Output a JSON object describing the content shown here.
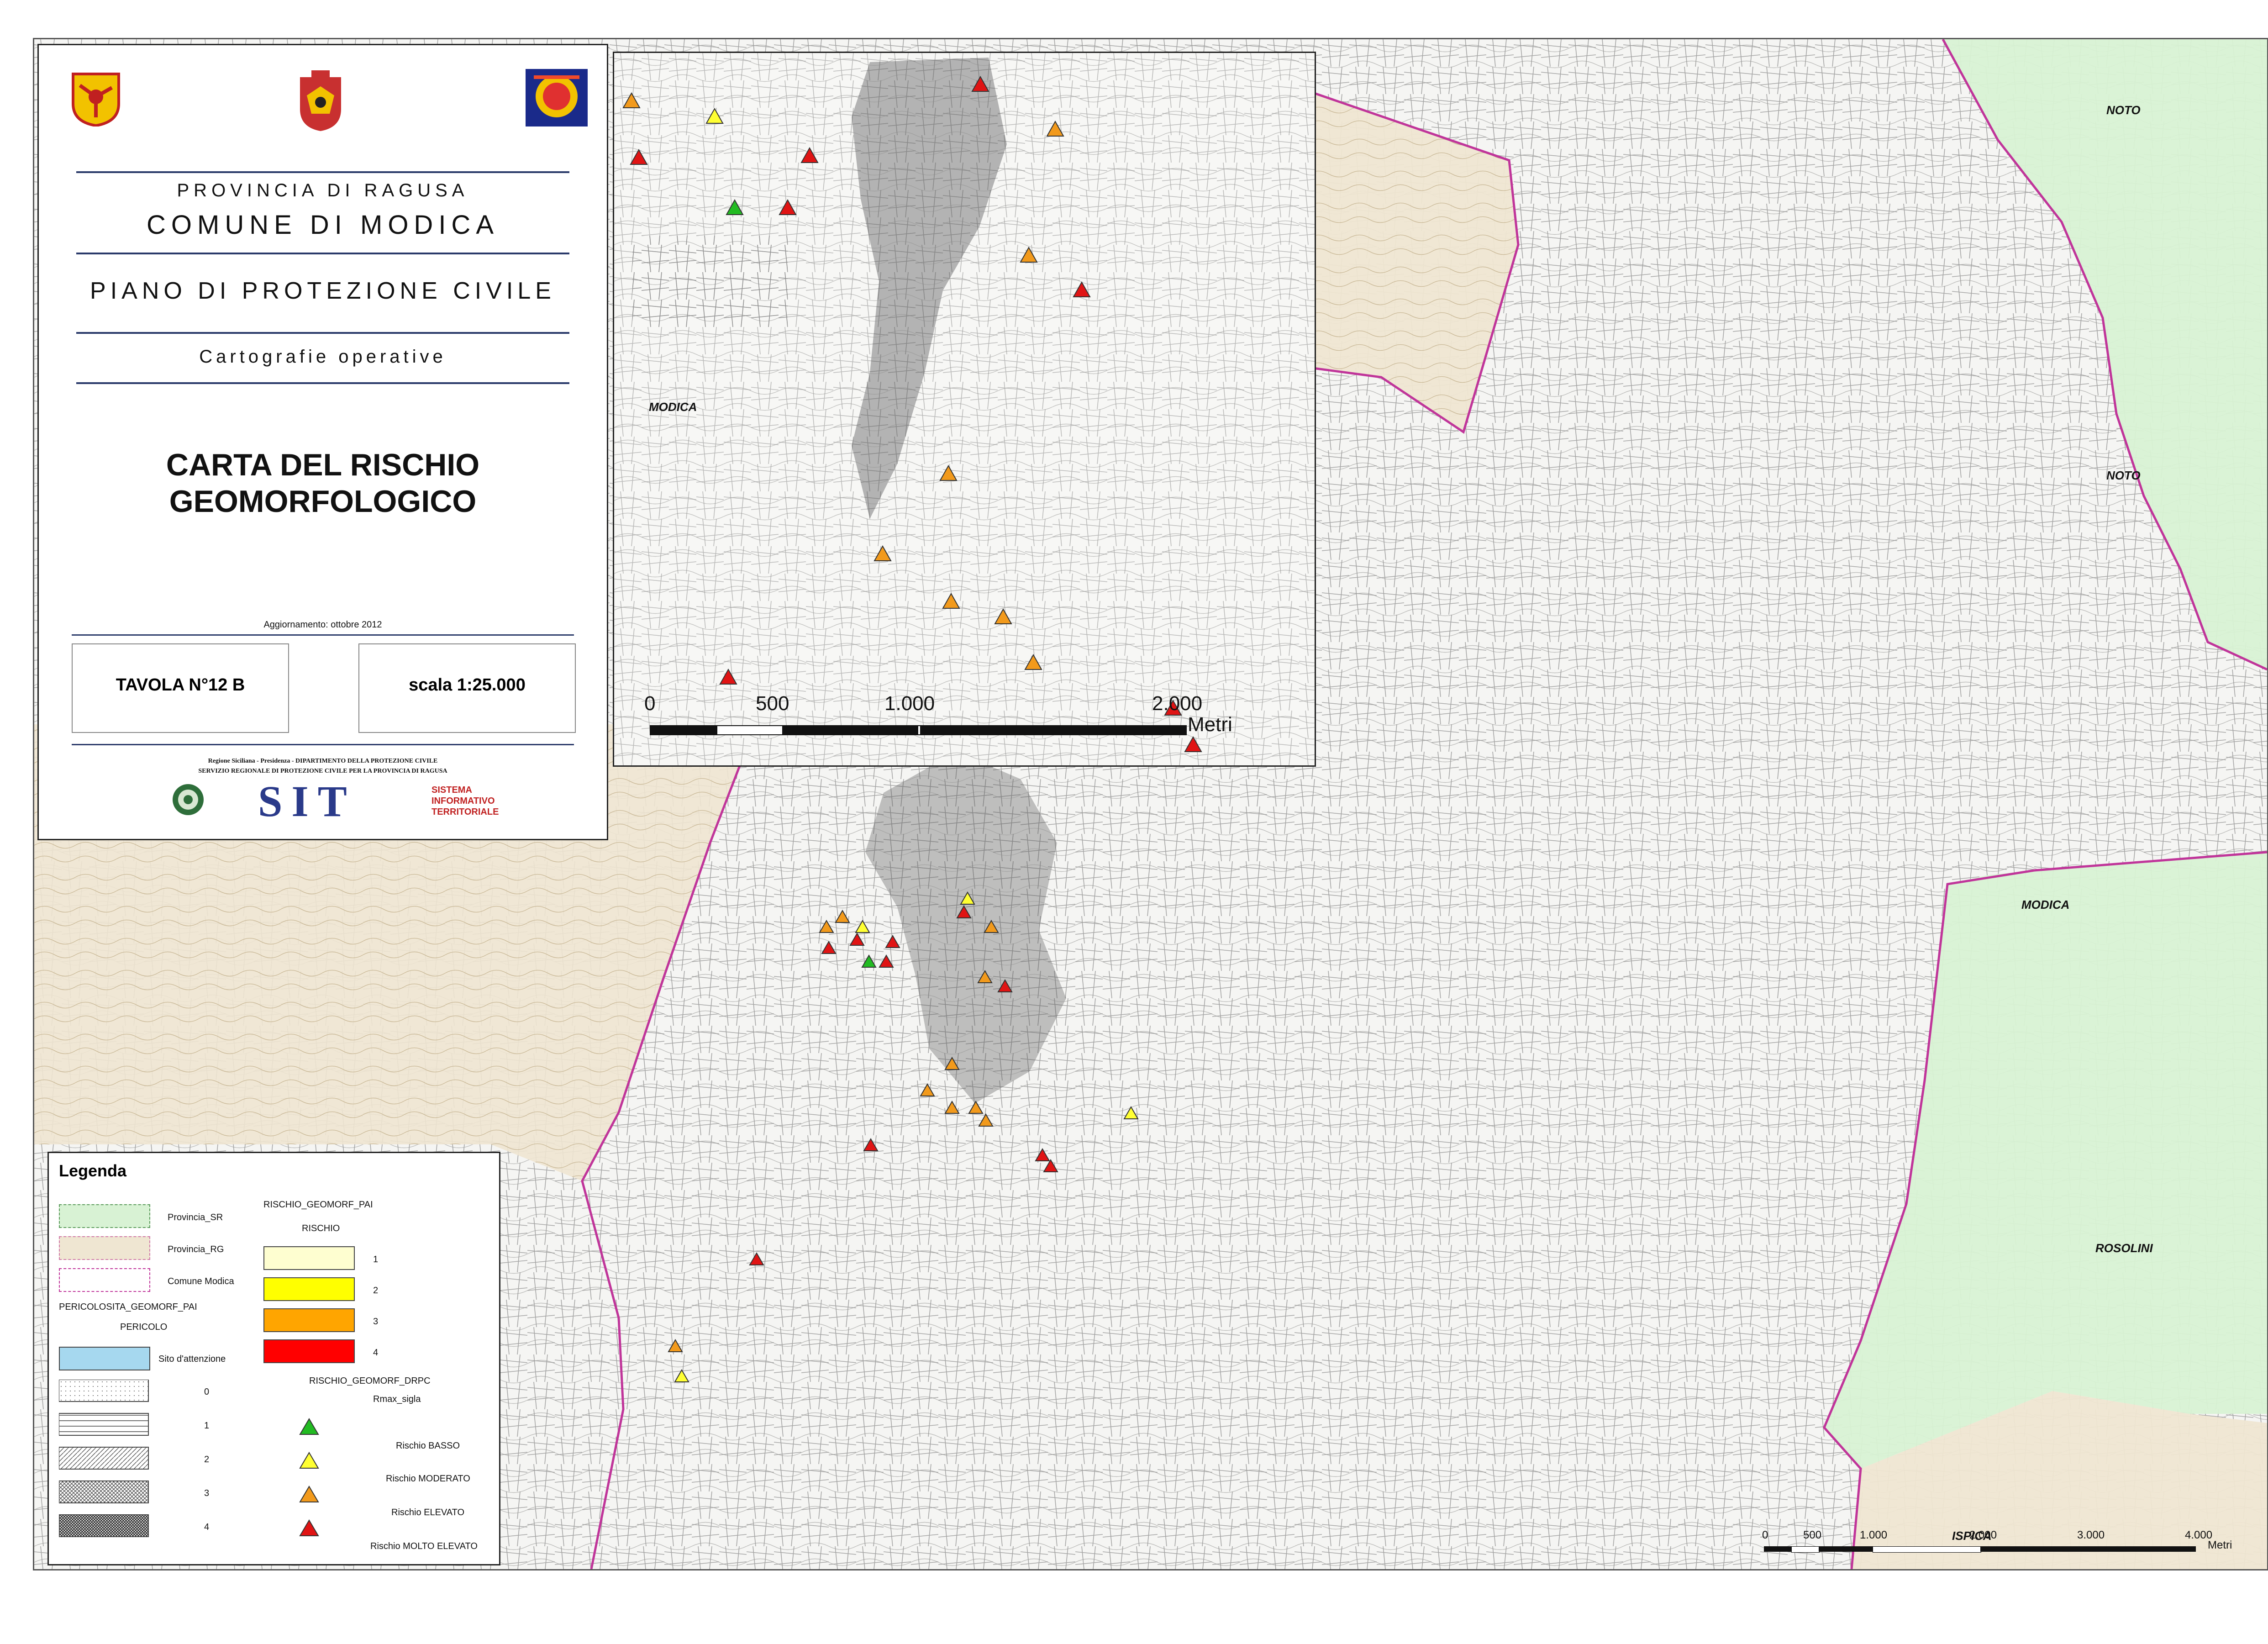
{
  "title_block": {
    "provincia": "PROVINCIA DI RAGUSA",
    "comune": "COMUNE DI MODICA",
    "piano": "PIANO DI PROTEZIONE CIVILE",
    "cartografie": "Cartografie operative",
    "carta_line1": "CARTA DEL RISCHIO",
    "carta_line2": "GEOMORFOLOGICO",
    "aggiornamento": "Aggiornamento: ottobre 2012",
    "tavola": "TAVOLA N°12 B",
    "scala": "scala 1:25.000",
    "regione_line1": "Regione Siciliana - Presidenza - DIPARTIMENTO DELLA PROTEZIONE CIVILE",
    "regione_line2": "SERVIZIO REGIONALE DI PROTEZIONE CIVILE PER LA PROVINCIA DI RAGUSA",
    "sit": "SIT",
    "sit_sub1": "SISTEMA",
    "sit_sub2": "INFORMATIVO",
    "sit_sub3": "TERRITORIALE"
  },
  "inset": {
    "place_label": "MODICA",
    "scale_labels": [
      "0",
      "500",
      "1.000",
      "2.000"
    ],
    "scale_unit": "Metri"
  },
  "main_map": {
    "places": [
      "NOTO",
      "NOTO",
      "MODICA",
      "ROSOLINI",
      "ISPICA"
    ],
    "scale_labels": [
      "0",
      "500",
      "1.000",
      "2.000",
      "3.000",
      "4.000"
    ],
    "scale_unit": "Metri"
  },
  "legend": {
    "title": "Legenda",
    "left_items": [
      "Provincia_SR",
      "Provincia_RG",
      "Comune Modica"
    ],
    "pericolosita_title": "PERICOLOSITA_GEOMORF_PAI",
    "pericolo_title": "PERICOLO",
    "sito": "Sito d'attenzione",
    "pericolo_classes": [
      "0",
      "1",
      "2",
      "3",
      "4"
    ],
    "rischio_pai_title": "RISCHIO_GEOMORF_PAI",
    "rischio_title": "RISCHIO",
    "rischio_classes": [
      "1",
      "2",
      "3",
      "4"
    ],
    "drpc_title": "RISCHIO_GEOMORF_DRPC",
    "rmax_title": "Rmax_sigla",
    "drpc_items": [
      "Rischio BASSO",
      "Rischio MODERATO",
      "Rischio ELEVATO",
      "Rischio MOLTO ELEVATO"
    ]
  },
  "colors": {
    "provincia_sr": "#d8f2d4",
    "provincia_rg": "#efe6d2",
    "comune_border": "#c0359a",
    "rischio_1": "#fefed0",
    "rischio_2": "#ffff00",
    "rischio_3": "#ffa500",
    "rischio_4": "#ff0000",
    "sito": "#a6d8ef",
    "basso": "#22bb22",
    "moderato": "#ffff33",
    "elevato": "#f29a1c",
    "molto_elevato": "#e01414"
  }
}
